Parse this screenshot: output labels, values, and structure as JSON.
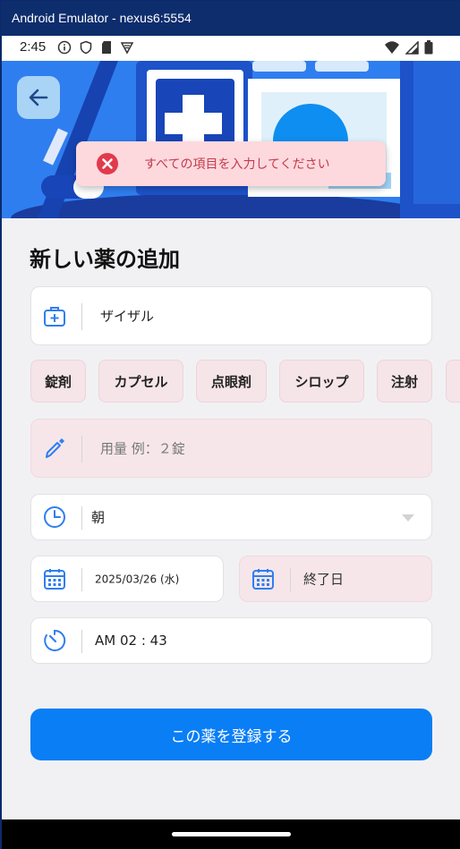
{
  "window": {
    "title": "Android Emulator - nexus6:5554"
  },
  "status_bar": {
    "time": "2:45"
  },
  "toast": {
    "message": "すべての項目を入力してください"
  },
  "page": {
    "title": "新しい薬の追加"
  },
  "form": {
    "medicine_name": {
      "value": "ザイザル"
    },
    "dosage_forms": [
      "錠剤",
      "カプセル",
      "点眼剤",
      "シロップ",
      "注射"
    ],
    "dosage": {
      "placeholder": "用量 例：２錠"
    },
    "timing": {
      "value": "朝"
    },
    "start_date": {
      "value": "2025/03/26 (水)"
    },
    "end_date": {
      "placeholder": "終了日"
    },
    "time": {
      "value": "AM 02 : 43"
    },
    "submit_label": "この薬を登録する"
  },
  "colors": {
    "accent": "#0a7ef5",
    "icon": "#2f7ef0",
    "error": "#c53a4b"
  }
}
